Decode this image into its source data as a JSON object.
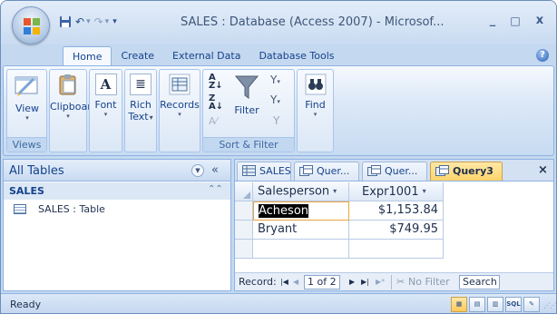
{
  "window": {
    "title": "SALES : Database (Access 2007) - Microsof...",
    "controls": {
      "minimize": "_",
      "maximize": "□",
      "close": "x"
    }
  },
  "quick_access": {
    "items": [
      "save-icon",
      "undo-icon",
      "redo-icon",
      "customize-icon"
    ]
  },
  "ribbon": {
    "tabs": [
      "Home",
      "Create",
      "External Data",
      "Database Tools"
    ],
    "active_tab": "Home",
    "groups": {
      "views": {
        "label": "Views",
        "view_button": "View"
      },
      "clipboard": {
        "button": "Clipboard"
      },
      "font": {
        "button": "Font"
      },
      "rich_text": {
        "line1": "Rich",
        "line2": "Text"
      },
      "records": {
        "button": "Records"
      },
      "sort_filter": {
        "label": "Sort & Filter",
        "filter_button": "Filter"
      },
      "find": {
        "button": "Find"
      }
    }
  },
  "nav_pane": {
    "header": "All Tables",
    "group": "SALES",
    "items": [
      {
        "label": "SALES : Table",
        "icon": "table-icon"
      }
    ]
  },
  "document": {
    "tabs": [
      {
        "label": "SALES",
        "icon": "table-icon"
      },
      {
        "label": "Quer...",
        "icon": "query-icon"
      },
      {
        "label": "Quer...",
        "icon": "query-icon"
      },
      {
        "label": "Query3",
        "icon": "query-icon",
        "active": true
      }
    ],
    "close": "×",
    "grid": {
      "columns": [
        "Salesperson",
        "Expr1001"
      ],
      "rows": [
        {
          "salesperson": "Acheson",
          "expr": "$1,153.84"
        },
        {
          "salesperson": "Bryant",
          "expr": "$749.95"
        }
      ]
    },
    "record_nav": {
      "label": "Record:",
      "first": "◀◀",
      "prev": "◀",
      "position": "1 of 2",
      "next": "▶",
      "last": "▶|",
      "new": "▶*",
      "filter": "No Filter",
      "search": "Search"
    }
  },
  "status": {
    "text": "Ready",
    "views": [
      "datasheet-view-icon",
      "pivottable-icon",
      "pivotchart-icon",
      "sql-view-icon",
      "design-view-icon"
    ]
  },
  "colors": {
    "accent": "#15428b",
    "active_tab": "#ffd36a",
    "ribbon_bg": "#dce8f7"
  }
}
